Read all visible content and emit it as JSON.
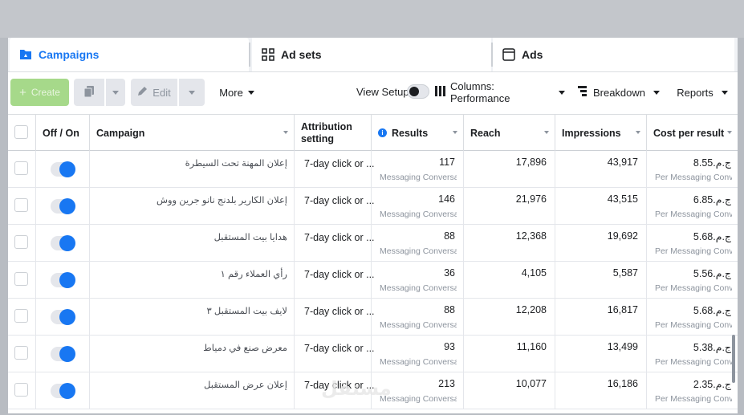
{
  "tabs": [
    {
      "label": "Campaigns",
      "icon": "folder-icon"
    },
    {
      "label": "Ad sets",
      "icon": "grid-icon"
    },
    {
      "label": "Ads",
      "icon": "ad-icon"
    }
  ],
  "toolbar": {
    "create_label": "Create",
    "edit_label": "Edit",
    "more_label": "More",
    "view_setup_label": "View Setup",
    "columns_label": "Columns: Performance",
    "breakdown_label": "Breakdown",
    "reports_label": "Reports"
  },
  "columns": {
    "off_on": "Off / On",
    "campaign": "Campaign",
    "attribution": "Attribution setting",
    "results": "Results",
    "reach": "Reach",
    "impressions": "Impressions",
    "cost": "Cost per result"
  },
  "rows": [
    {
      "campaign": "إعلان المهنة تحت السيطرة",
      "attribution": "7-day click or ...",
      "results": "117",
      "results_sub": "Messaging Conversa...",
      "reach": "17,896",
      "impressions": "43,917",
      "cost": "ج.م.8.55",
      "cost_sub": "Per Messaging Conv..."
    },
    {
      "campaign": "إعلان الكارير بلدنج نانو جرين ووش",
      "attribution": "7-day click or ...",
      "results": "146",
      "results_sub": "Messaging Conversa...",
      "reach": "21,976",
      "impressions": "43,515",
      "cost": "ج.م.6.85",
      "cost_sub": "Per Messaging Conv..."
    },
    {
      "campaign": "هدايا بيت المستقبل",
      "attribution": "7-day click or ...",
      "results": "88",
      "results_sub": "Messaging Conversa...",
      "reach": "12,368",
      "impressions": "19,692",
      "cost": "ج.م.5.68",
      "cost_sub": "Per Messaging Conv..."
    },
    {
      "campaign": "رأي العملاء رقم ١",
      "attribution": "7-day click or ...",
      "results": "36",
      "results_sub": "Messaging Conversa...",
      "reach": "4,105",
      "impressions": "5,587",
      "cost": "ج.م.5.56",
      "cost_sub": "Per Messaging Conv..."
    },
    {
      "campaign": "لايف بيت المستقبل ٣",
      "attribution": "7-day click or ...",
      "results": "88",
      "results_sub": "Messaging Conversa...",
      "reach": "12,208",
      "impressions": "16,817",
      "cost": "ج.م.5.68",
      "cost_sub": "Per Messaging Conv..."
    },
    {
      "campaign": "معرض صنع في دمياط",
      "attribution": "7-day click or ...",
      "results": "93",
      "results_sub": "Messaging Conversa...",
      "reach": "11,160",
      "impressions": "13,499",
      "cost": "ج.م.5.38",
      "cost_sub": "Per Messaging Conv..."
    },
    {
      "campaign": "إعلان عرض المستقبل",
      "attribution": "7-day click or ...",
      "results": "213",
      "results_sub": "Messaging Conversa...",
      "reach": "10,077",
      "impressions": "16,186",
      "cost": "ج.م.2.35",
      "cost_sub": "Per Messaging Conv..."
    }
  ],
  "watermark": "مستقل",
  "colors": {
    "accent": "#1877f2",
    "create_disabled": "#a6d98a"
  }
}
